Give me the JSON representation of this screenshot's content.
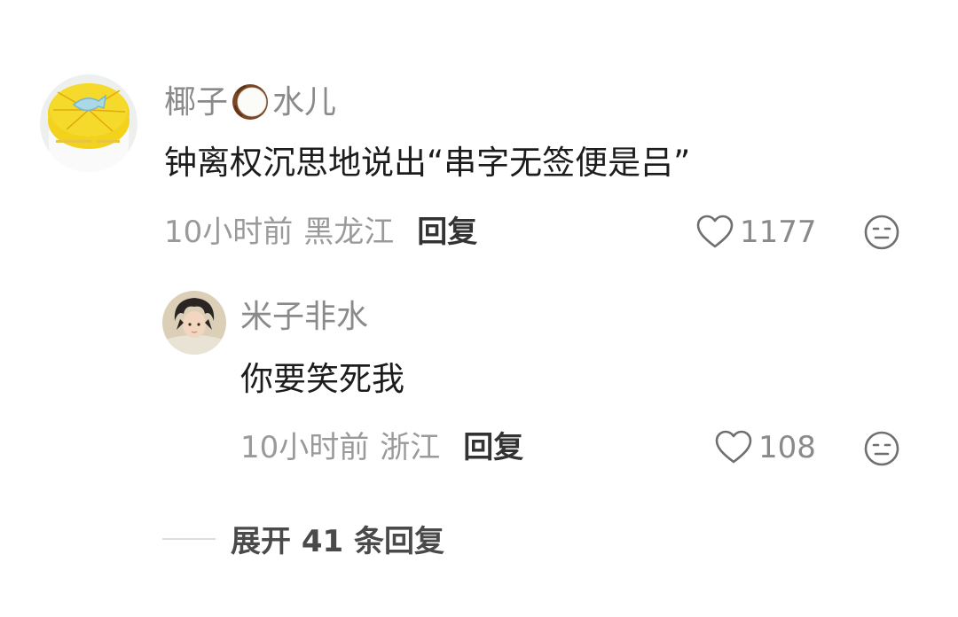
{
  "comment": {
    "username_prefix": "椰子",
    "username_suffix": "水儿",
    "username_emoji": "coconut-emoji",
    "text": "钟离权沉思地说出“串字无签便是吕”",
    "time": "10小时前",
    "location": "黑龙江",
    "reply_label": "回复",
    "likes": "1177",
    "icons": [
      "heart-icon",
      "dislike-face-icon"
    ]
  },
  "reply": {
    "username": "米子非水",
    "text": "你要笑死我",
    "time": "10小时前",
    "location": "浙江",
    "reply_label": "回复",
    "likes": "108",
    "icons": [
      "heart-icon",
      "dislike-face-icon"
    ]
  },
  "expand": {
    "label": "展开 41 条回复"
  },
  "colors": {
    "username": "#8a8a8a",
    "text": "#1c1c1c",
    "meta": "#9a9a9a",
    "action": "#333333",
    "avatar_cake": "#f2d21b"
  }
}
